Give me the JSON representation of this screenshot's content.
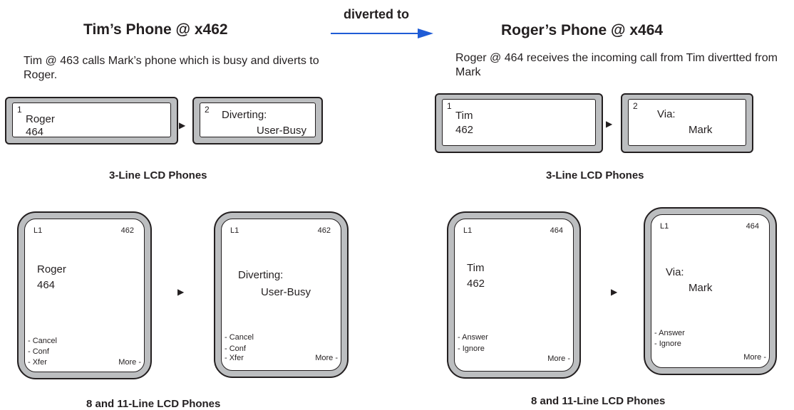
{
  "diverted_label": "diverted to",
  "left": {
    "title": "Tim’s Phone @ x462",
    "description": "Tim @ 463 calls Mark’s phone which is busy and diverts to Roger.",
    "lcd3": {
      "screen1": {
        "index": "1",
        "line1": "Roger",
        "line2": "464"
      },
      "screen2": {
        "index": "2",
        "line1": "Diverting:",
        "line2": "User-Busy"
      },
      "caption": "3-Line LCD Phones"
    },
    "lcd8": {
      "screen1": {
        "line": "L1",
        "ext": "462",
        "line1": "Roger",
        "line2": "464",
        "softkeys": [
          "- Cancel",
          "- Conf",
          "- Xfer"
        ],
        "more": "More -"
      },
      "screen2": {
        "line": "L1",
        "ext": "462",
        "line1": "Diverting:",
        "line2": "User-Busy",
        "softkeys": [
          "- Cancel",
          "- Conf",
          "- Xfer"
        ],
        "more": "More -"
      },
      "caption": "8 and 11-Line LCD Phones"
    }
  },
  "right": {
    "title": "Roger’s Phone @ x464",
    "description": "Roger @ 464 receives the incoming call from Tim divertted from Mark",
    "lcd3": {
      "screen1": {
        "index": "1",
        "line1": "Tim",
        "line2": "462"
      },
      "screen2": {
        "index": "2",
        "line1": "Via:",
        "line2": "Mark"
      },
      "caption": "3-Line LCD Phones"
    },
    "lcd8": {
      "screen1": {
        "line": "L1",
        "ext": "464",
        "line1": "Tim",
        "line2": "462",
        "softkeys": [
          "- Answer",
          "- Ignore"
        ],
        "more": "More -"
      },
      "screen2": {
        "line": "L1",
        "ext": "464",
        "line1": "Via:",
        "line2": "Mark",
        "softkeys": [
          "- Answer",
          "- Ignore"
        ],
        "more": "More -"
      },
      "caption": "8 and 11-Line LCD Phones"
    }
  },
  "colors": {
    "arrow": "#1f5cd6",
    "bezel": "#bcbec0",
    "outline": "#231f20"
  },
  "icons": {
    "flow_arrow": "right-triangle-icon",
    "diverted_arrow": "arrow-right-icon"
  }
}
